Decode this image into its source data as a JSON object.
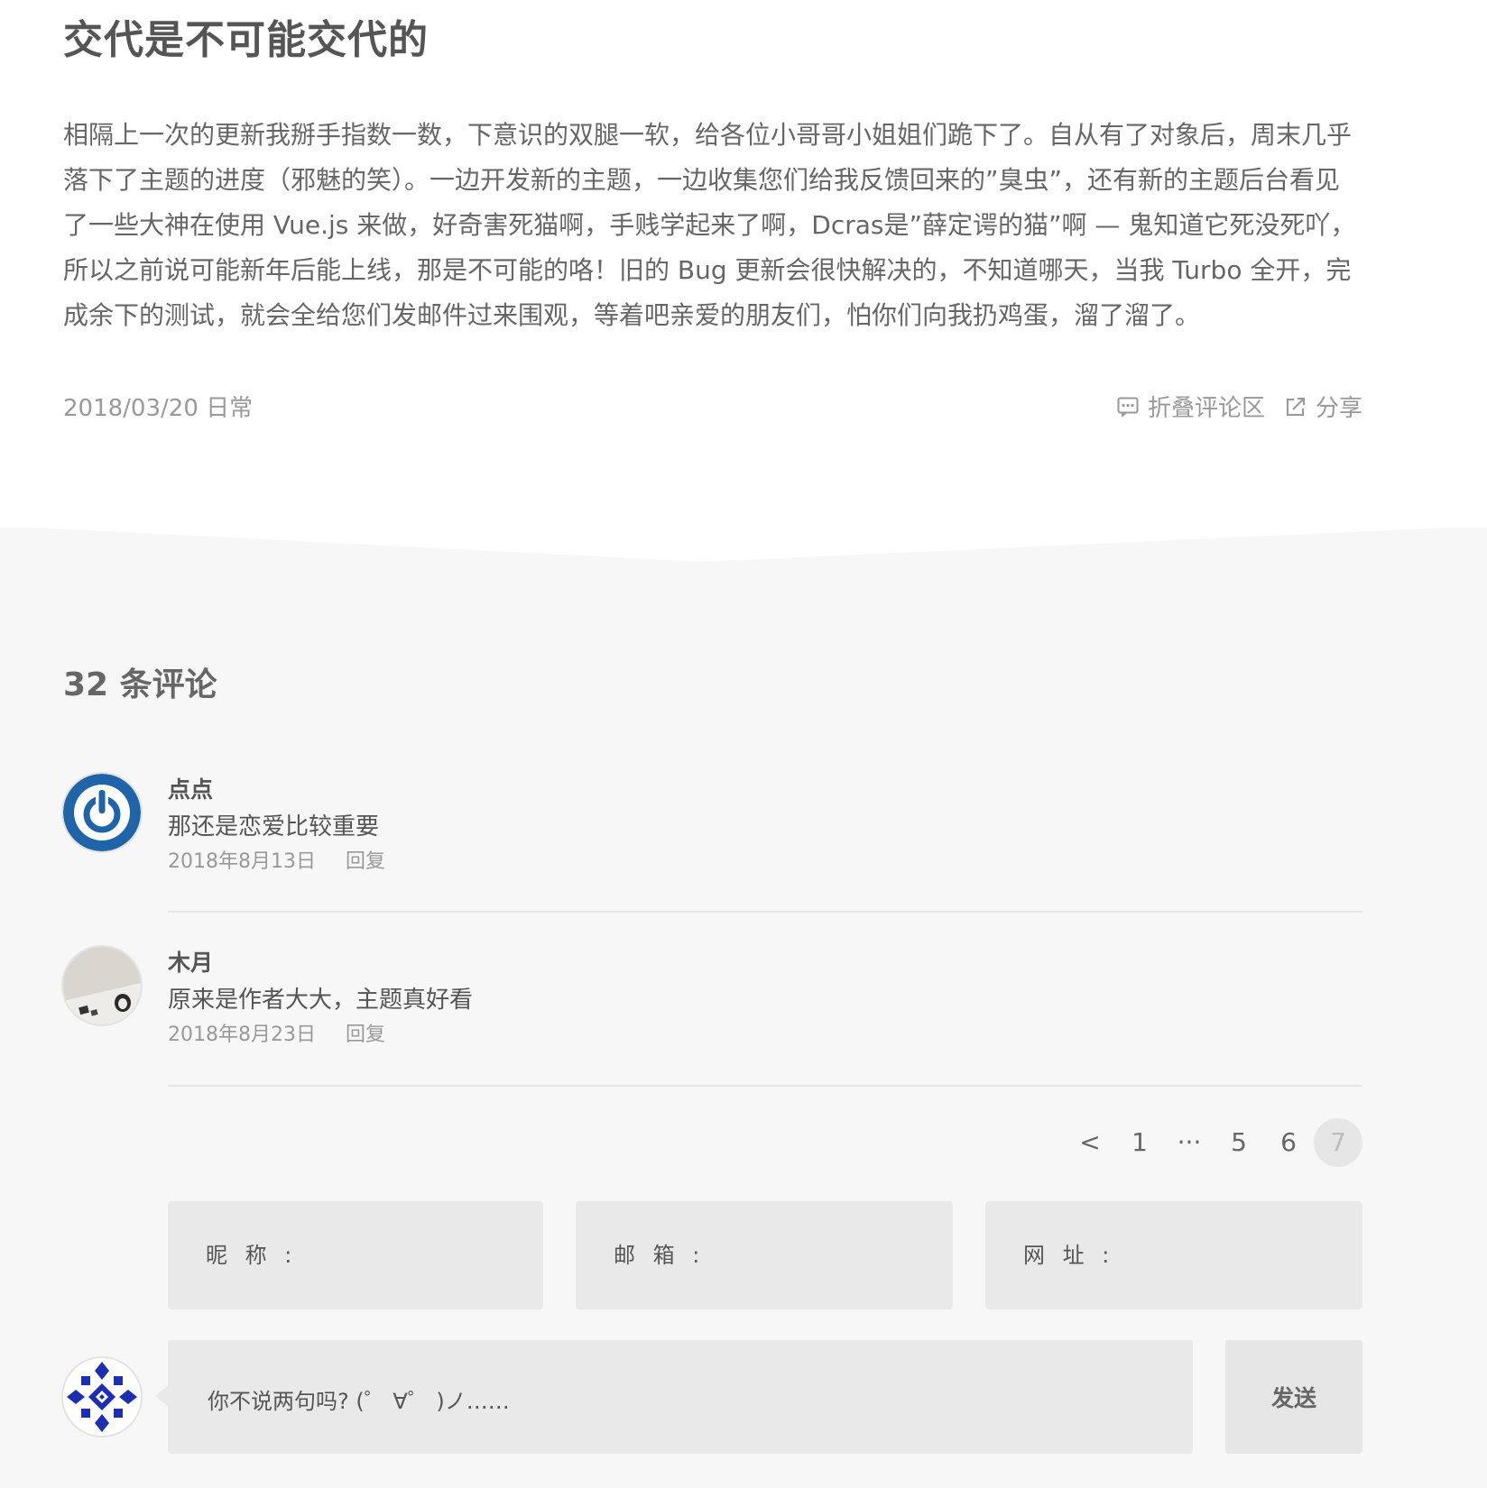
{
  "post": {
    "title": "交代是不可能交代的",
    "body": "相隔上一次的更新我掰手指数一数，下意识的双腿一软，给各位小哥哥小姐姐们跪下了。自从有了对象后，周末几乎落下了主题的进度（邪魅的笑）。一边开发新的主题，一边收集您们给我反馈回来的”臭虫”，还有新的主题后台看见了一些大神在使用 Vue.js 来做，好奇害死猫啊，手贱学起来了啊，Dcras是”薛定谔的猫”啊 — 鬼知道它死没死吖，所以之前说可能新年后能上线，那是不可能的咯！旧的 Bug 更新会很快解决的，不知道哪天，当我 Turbo 全开，完成余下的测试，就会全给您们发邮件过来围观，等着吧亲爱的朋友们，怕你们向我扔鸡蛋，溜了溜了。",
    "date_category": "2018/03/20 日常",
    "collapse_label": "折叠评论区",
    "share_label": "分享"
  },
  "comments": {
    "heading": "32 条评论",
    "items": [
      {
        "author": "点点",
        "text": "那还是恋爱比较重要",
        "date": "2018年8月13日",
        "reply_label": "回复"
      },
      {
        "author": "木月",
        "text": "原来是作者大大，主题真好看",
        "date": "2018年8月23日",
        "reply_label": "回复"
      }
    ],
    "pagination": {
      "prev": "<",
      "pages": [
        "1",
        "···",
        "5",
        "6",
        "7"
      ],
      "current": "7"
    }
  },
  "form": {
    "nickname_label": "昵 称 :",
    "email_label": "邮 箱 :",
    "website_label": "网 址 :",
    "comment_placeholder": "你不说两句吗? (゜ ∀゜ )ノ……",
    "send_label": "发送"
  },
  "colors": {
    "page_bg": "#ffffff",
    "comments_bg": "#f7f7f7",
    "field_bg": "#e9e9e9",
    "text": "#555555",
    "muted": "#999999",
    "avatar_blue": "#1f63a9"
  },
  "icons": {
    "collapse": "comment-bubble-icon",
    "share": "share-external-icon"
  }
}
